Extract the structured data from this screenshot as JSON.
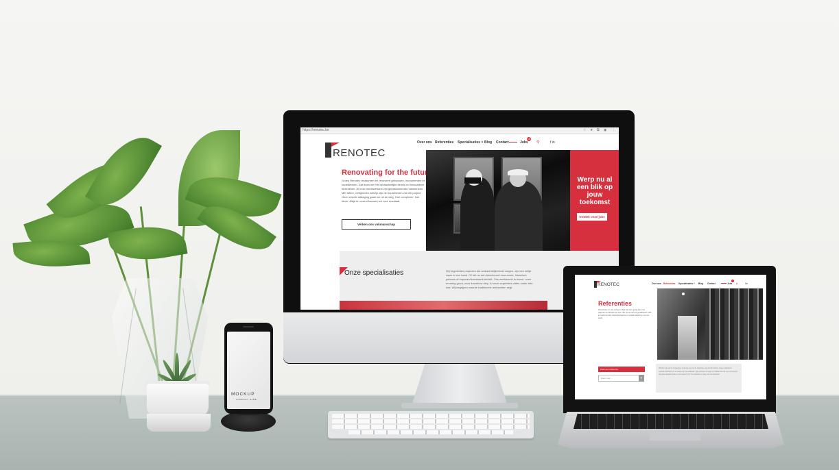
{
  "monitor": {
    "browser": {
      "url": "https://renotec.be",
      "icons": [
        "star-icon",
        "bookmark-icon",
        "extensions-icon",
        "profile-icon"
      ]
    },
    "site": {
      "logo": "RENOTEC",
      "nav": [
        "Over ons",
        "Referenties",
        "Specialisaties ˅",
        "Blog",
        "Contact",
        "Jobs"
      ],
      "jobs_badge": "16",
      "social": "f in ",
      "hero": {
        "title": "Renovating for the future",
        "text": "Groep Renotec restaureert en renoveert gebouwen, monumenten en kunstwerken. Dat doen we met ambachtelijke kennis en innovatieve technieken. Al onze medewerkers zijn gepassioneerde vakmensen. Met talent, veiligheden welzijn zijn de bouwstenen van elk project. Geen enkele uitdaging gaan we uit de weg. Hoe complexer, hoe liever. Altijd en overal bouwen we voor resultaat.",
        "button": "Verken ons vakmanschap"
      },
      "red_panel": {
        "title": "Werp nu al een blik op jouw toekomst",
        "button": "Ontdek onze jobs"
      },
      "specialisaties": {
        "title": "Onze specialisaties",
        "text": "Wij begeleiden projecten die ambachtelijkerheid vragen, zijn een kritije raam in een hand. Of het nu een beschermd monument, historisch gebouw of imposant kunstwerk betreft. Ons werkterrein is breed, onze ervaring groot, onze knowhow diep. Al onze expertises zitten onder één dak. Wij begrijpen waarde traditionele ambachten zegt."
      }
    }
  },
  "phone": {
    "brand": "MOCKUP",
    "sub": "COMPANY NAME"
  },
  "laptop": {
    "site": {
      "logo": "RENOTEC",
      "nav": [
        "Over ons",
        "Referenties",
        "Specialisaties ˅",
        "Blog",
        "Contact",
        "Jobs"
      ],
      "social": "f in ",
      "title": "Referenties",
      "text": "Wij vertellen zo veel verhalen. Maar dat doen graag aan onze projecten en dat laten we zien. Hier zijn we trots op gerealiseerd. Laat je inspireren door referentieprojecten en ontdek waarom je met ons werkt.",
      "search_button": "Zoek een referentie",
      "search_placeholder": "Zoek naar ...",
      "box_text": "Wij zijn trots op de honderden projecten die we de afgelopen decennia hebben mogen realiseren. Gebruik de filters om te zoeken op specialisatie, type gebouw of regio en ontdek hoe wij voor elk project de juiste aanpak vinden, met respect voor het verleden en oog voor de toekomst."
    }
  }
}
